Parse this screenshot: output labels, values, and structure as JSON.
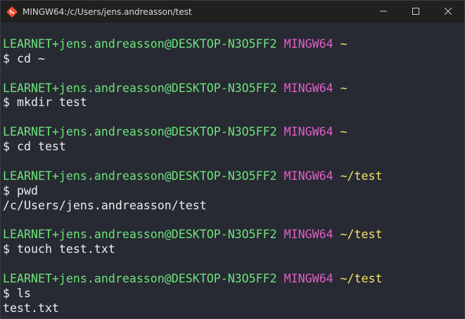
{
  "window": {
    "title": "MINGW64:/c/Users/jens.andreasson/test",
    "icon": "git-bash-icon",
    "controls": [
      "minimize-icon",
      "maximize-icon",
      "close-icon"
    ]
  },
  "terminal": {
    "colors": {
      "background": "#272a33",
      "user_host": "#6ee37a",
      "mingw": "#e25fc6",
      "path": "#f0e566",
      "text": "#ececec"
    },
    "blocks": [
      {
        "prompt": {
          "user_host": "LEARNET+jens.andreasson@DESKTOP-N3O5FF2",
          "env": "MINGW64",
          "path": "~"
        },
        "command": "$ cd ~",
        "output": []
      },
      {
        "prompt": {
          "user_host": "LEARNET+jens.andreasson@DESKTOP-N3O5FF2",
          "env": "MINGW64",
          "path": "~"
        },
        "command": "$ mkdir test",
        "output": []
      },
      {
        "prompt": {
          "user_host": "LEARNET+jens.andreasson@DESKTOP-N3O5FF2",
          "env": "MINGW64",
          "path": "~"
        },
        "command": "$ cd test",
        "output": []
      },
      {
        "prompt": {
          "user_host": "LEARNET+jens.andreasson@DESKTOP-N3O5FF2",
          "env": "MINGW64",
          "path": "~/test"
        },
        "command": "$ pwd",
        "output": [
          "/c/Users/jens.andreasson/test"
        ]
      },
      {
        "prompt": {
          "user_host": "LEARNET+jens.andreasson@DESKTOP-N3O5FF2",
          "env": "MINGW64",
          "path": "~/test"
        },
        "command": "$ touch test.txt",
        "output": []
      },
      {
        "prompt": {
          "user_host": "LEARNET+jens.andreasson@DESKTOP-N3O5FF2",
          "env": "MINGW64",
          "path": "~/test"
        },
        "command": "$ ls",
        "output": [
          "test.txt"
        ]
      }
    ]
  }
}
